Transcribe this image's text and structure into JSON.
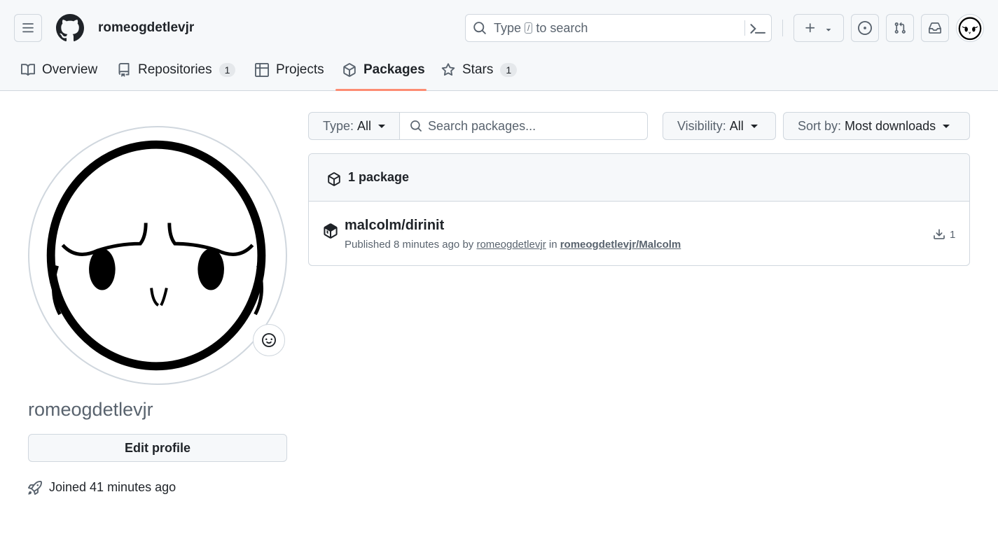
{
  "header": {
    "username": "romeogdetlevjr",
    "search": {
      "prefix": "Type",
      "key": "/",
      "suffix": "to search"
    }
  },
  "tabs": [
    {
      "label": "Overview",
      "icon": "book-icon"
    },
    {
      "label": "Repositories",
      "count": "1",
      "icon": "repo-icon"
    },
    {
      "label": "Projects",
      "icon": "table-icon"
    },
    {
      "label": "Packages",
      "icon": "package-icon",
      "active": true
    },
    {
      "label": "Stars",
      "count": "1",
      "icon": "star-icon"
    }
  ],
  "profile": {
    "name": "romeogdetlevjr",
    "edit_label": "Edit profile",
    "joined": "Joined 41 minutes ago"
  },
  "filters": {
    "type_label": "Type:",
    "type_value": "All",
    "search_placeholder": "Search packages...",
    "visibility_label": "Visibility:",
    "visibility_value": "All",
    "sort_label": "Sort by:",
    "sort_value": "Most downloads"
  },
  "packages": {
    "count_label": "1 package",
    "items": [
      {
        "name": "malcolm/dirinit",
        "published": "Published 8 minutes ago by",
        "author": "romeogdetlevjr",
        "in_text": "in",
        "repo": "romeogdetlevjr/Malcolm",
        "downloads": "1"
      }
    ]
  },
  "colors": {
    "accent_underline": "#fd8c73",
    "border": "#d0d7de",
    "muted_text": "#59636e",
    "header_bg": "#f6f8fa"
  }
}
